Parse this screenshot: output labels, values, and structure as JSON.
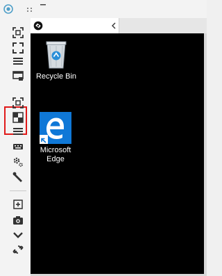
{
  "titlebar": {
    "icons": [
      "app-logo-icon",
      "drag-handle-icon",
      "minimize-icon"
    ]
  },
  "toolbar": {
    "items": [
      "focus-icon",
      "fullscreen-icon",
      "menu-icon",
      "window-icon",
      "focus-icon",
      "layout-icon",
      "menu-icon",
      "keyboard-icon",
      "settings-icon",
      "wrench-icon",
      "add-window-icon",
      "camera-icon",
      "chevron-down-icon",
      "link-icon"
    ],
    "highlighted_index": 4,
    "highlight_color": "#e01919"
  },
  "tab": {
    "icon": "session-icon",
    "close_icon": "chevron-left-icon"
  },
  "desktop": {
    "background": "#000000",
    "icons": [
      {
        "name": "recycle-bin",
        "line1": "Recycle Bin",
        "line2": ""
      },
      {
        "name": "microsoft-edge",
        "line1": "Microsoft",
        "line2": "Edge"
      }
    ]
  },
  "colors": {
    "edge_blue": "#0f78d7",
    "accent_red": "#e01919"
  }
}
